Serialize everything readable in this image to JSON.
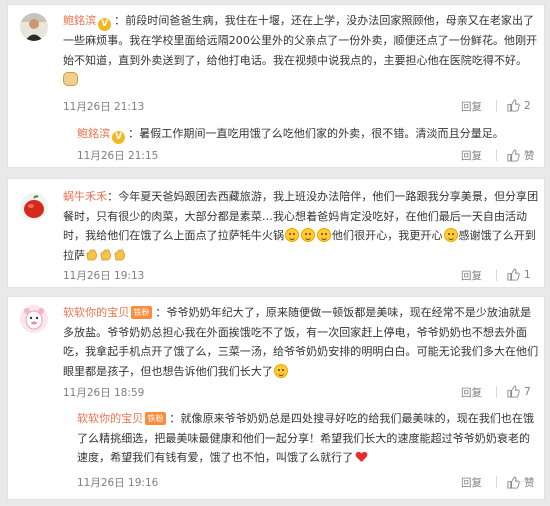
{
  "comments": [
    {
      "user": "鲍銘滨",
      "text": "：前段时间爸爸生病，我住在十堰，还在上学，没办法回家照顾他，母亲又在老家出了一些麻烦事。我在学校里面给远隔200公里外的父亲点了一份外卖，顺便还点了一份鲜花。他刚开始不知道，直到外卖送到了，给他打电话。我在视频中说我点的，主要担心他在医院吃得不好。",
      "time": "11月26日 21:13",
      "reply_label": "回复",
      "likes": "2",
      "sub_reply": {
        "user": "鲍銘滨",
        "text": "：暑假工作期间一直吃用饿了么吃他们家的外卖，很不错。清淡而且分量足。",
        "time": "11月26日 21:15",
        "reply_label": "回复",
        "like_label": "赞"
      }
    },
    {
      "user": "蜗牛禾禾",
      "text_parts": [
        "：今年夏天爸妈跟团去西藏旅游，我上班没办法陪伴，他们一路跟我分享美景，但分享团餐时，只有很少的肉菜，大部分都是素菜…我心想着爸妈肯定没吃好，在他们最后一天自由活动时，我给他们在饿了么上面点了拉萨牦牛火锅",
        "他们很开心，我更开心",
        "感谢饿了么开到拉萨"
      ],
      "time": "11月26日 19:13",
      "reply_label": "回复",
      "likes": "1"
    },
    {
      "user": "软软你的宝贝",
      "badge": "铁粉",
      "text": "：爷爷奶奶年纪大了，原来随便做一顿饭都是美味，现在经常不是少放油就是多放盐。爷爷奶奶总担心我在外面挨饿吃不了饭，有一次回家赶上停电，爷爷奶奶也不想去外面吃，我拿起手机点开了饿了么，三菜一汤，给爷爷奶奶安排的明明白白。可能无论我们多大在他们眼里都是孩子，但也想告诉他们我们长大了",
      "time": "11月26日 18:59",
      "reply_label": "回复",
      "likes": "7",
      "sub_reply": {
        "user": "软软你的宝贝",
        "badge": "铁粉",
        "text": "：就像原来爷爷奶奶总是四处搜寻好吃的给我们最美味的，现在我们也在饿了么精挑细选，把最美味最健康和他们一起分享！希望我们长大的速度能超过爷爷奶奶衰老的速度，希望我们有钱有爱，饿了也不怕，叫饿了么就行了",
        "time": "11月26日 19:16",
        "reply_label": "回复",
        "like_label": "赞"
      }
    }
  ]
}
